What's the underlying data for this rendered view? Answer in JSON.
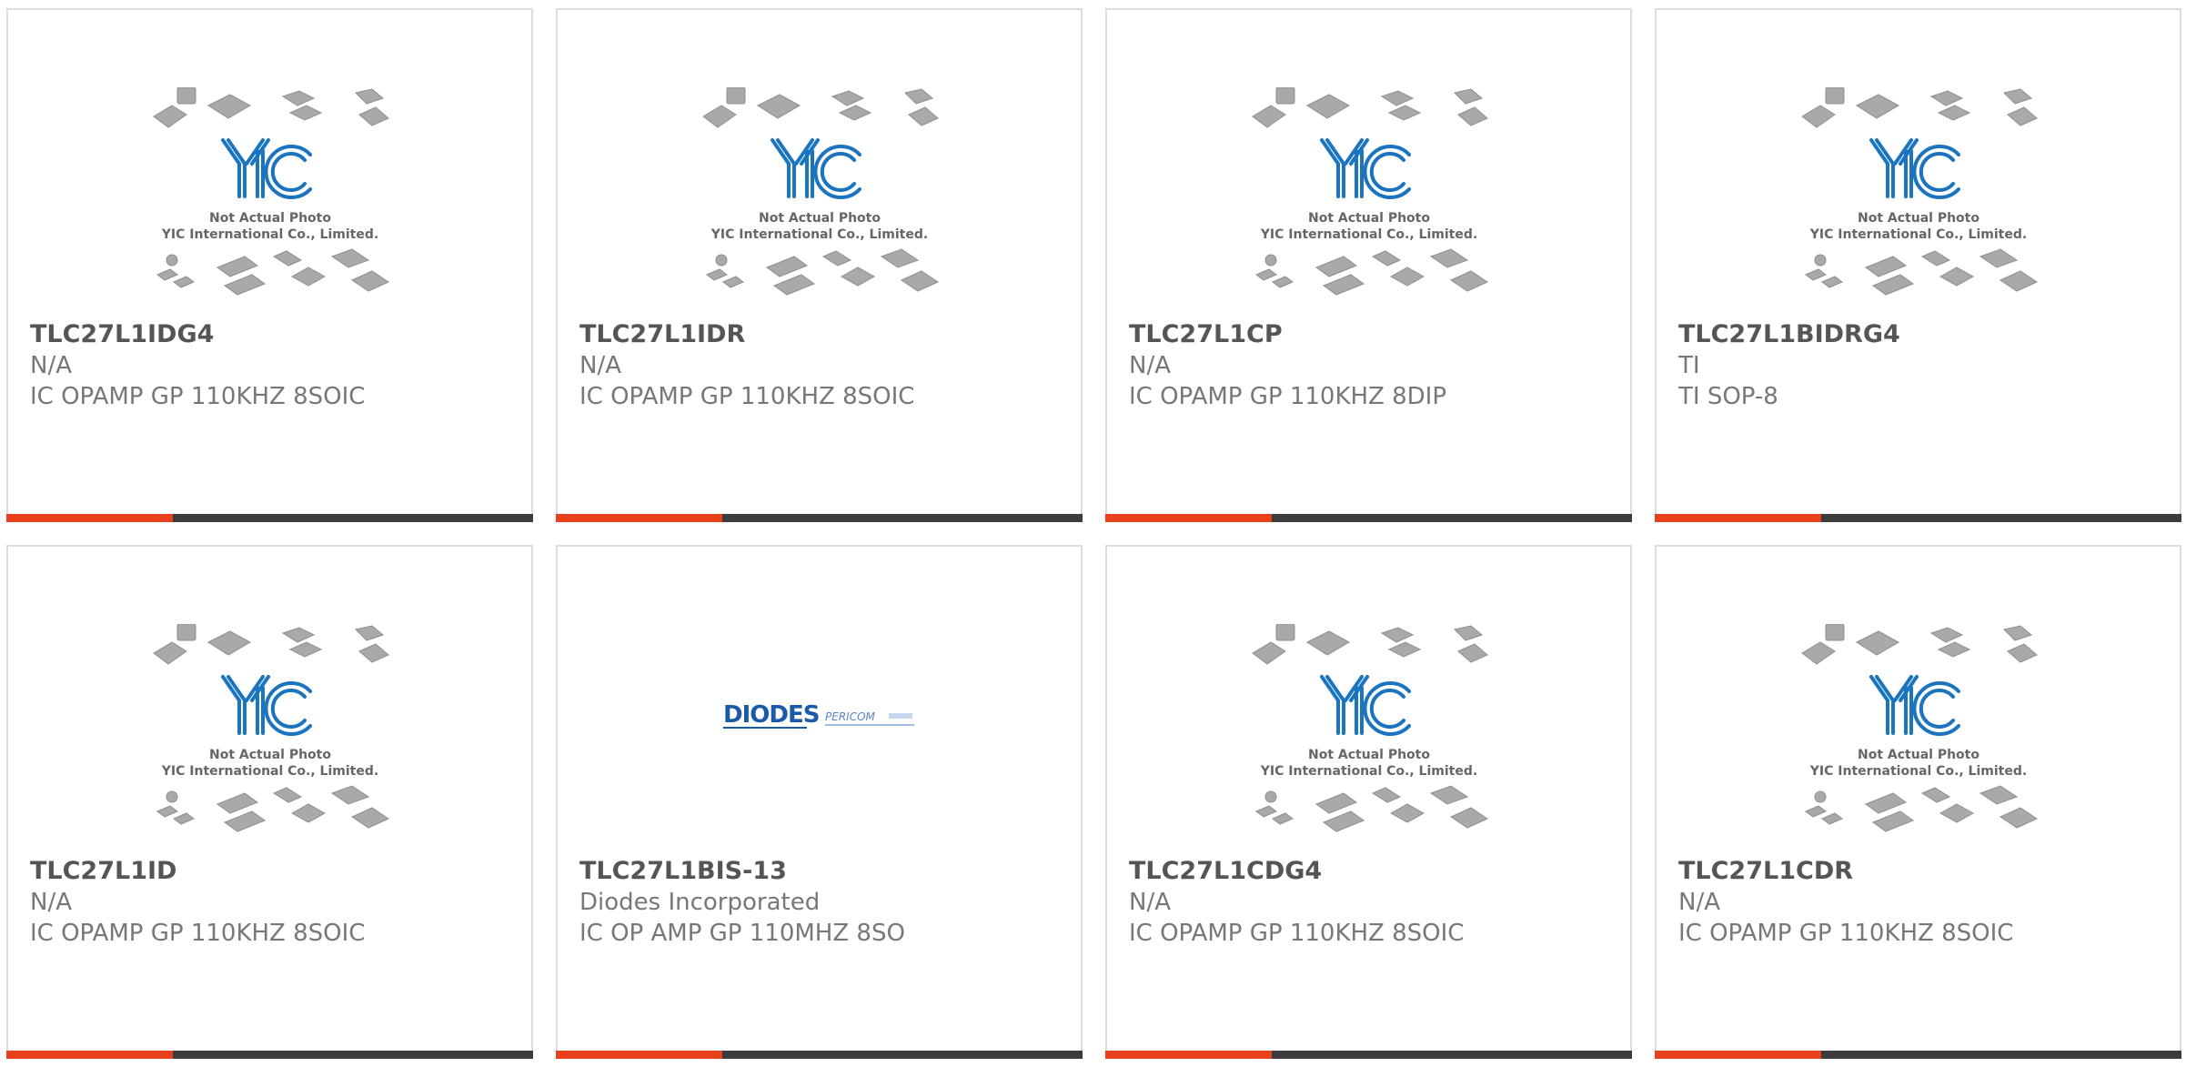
{
  "theme": {
    "accent": "#e8401c",
    "bar": "#3c3c3c",
    "text": "#777777",
    "title": "#555555"
  },
  "placeholder": {
    "line1": "Not Actual Photo",
    "line2": "YIC International Co., Limited.",
    "logo": "YIC"
  },
  "diodes_logo": {
    "brand": "DIODES",
    "sub": "PERICOM"
  },
  "cards": [
    {
      "part": "TLC27L1IDG4",
      "manufacturer": "N/A",
      "description": "IC OPAMP GP 110KHZ 8SOIC",
      "image": "yic-placeholder"
    },
    {
      "part": "TLC27L1IDR",
      "manufacturer": "N/A",
      "description": "IC OPAMP GP 110KHZ 8SOIC",
      "image": "yic-placeholder"
    },
    {
      "part": "TLC27L1CP",
      "manufacturer": "N/A",
      "description": "IC OPAMP GP 110KHZ 8DIP",
      "image": "yic-placeholder"
    },
    {
      "part": "TLC27L1BIDRG4",
      "manufacturer": "TI",
      "description": "TI SOP-8",
      "image": "yic-placeholder"
    },
    {
      "part": "TLC27L1ID",
      "manufacturer": "N/A",
      "description": "IC OPAMP GP 110KHZ 8SOIC",
      "image": "yic-placeholder"
    },
    {
      "part": "TLC27L1BIS-13",
      "manufacturer": "Diodes Incorporated",
      "description": "IC OP AMP GP 110MHZ 8SO",
      "image": "diodes-logo"
    },
    {
      "part": "TLC27L1CDG4",
      "manufacturer": "N/A",
      "description": "IC OPAMP GP 110KHZ 8SOIC",
      "image": "yic-placeholder"
    },
    {
      "part": "TLC27L1CDR",
      "manufacturer": "N/A",
      "description": "IC OPAMP GP 110KHZ 8SOIC",
      "image": "yic-placeholder"
    }
  ]
}
